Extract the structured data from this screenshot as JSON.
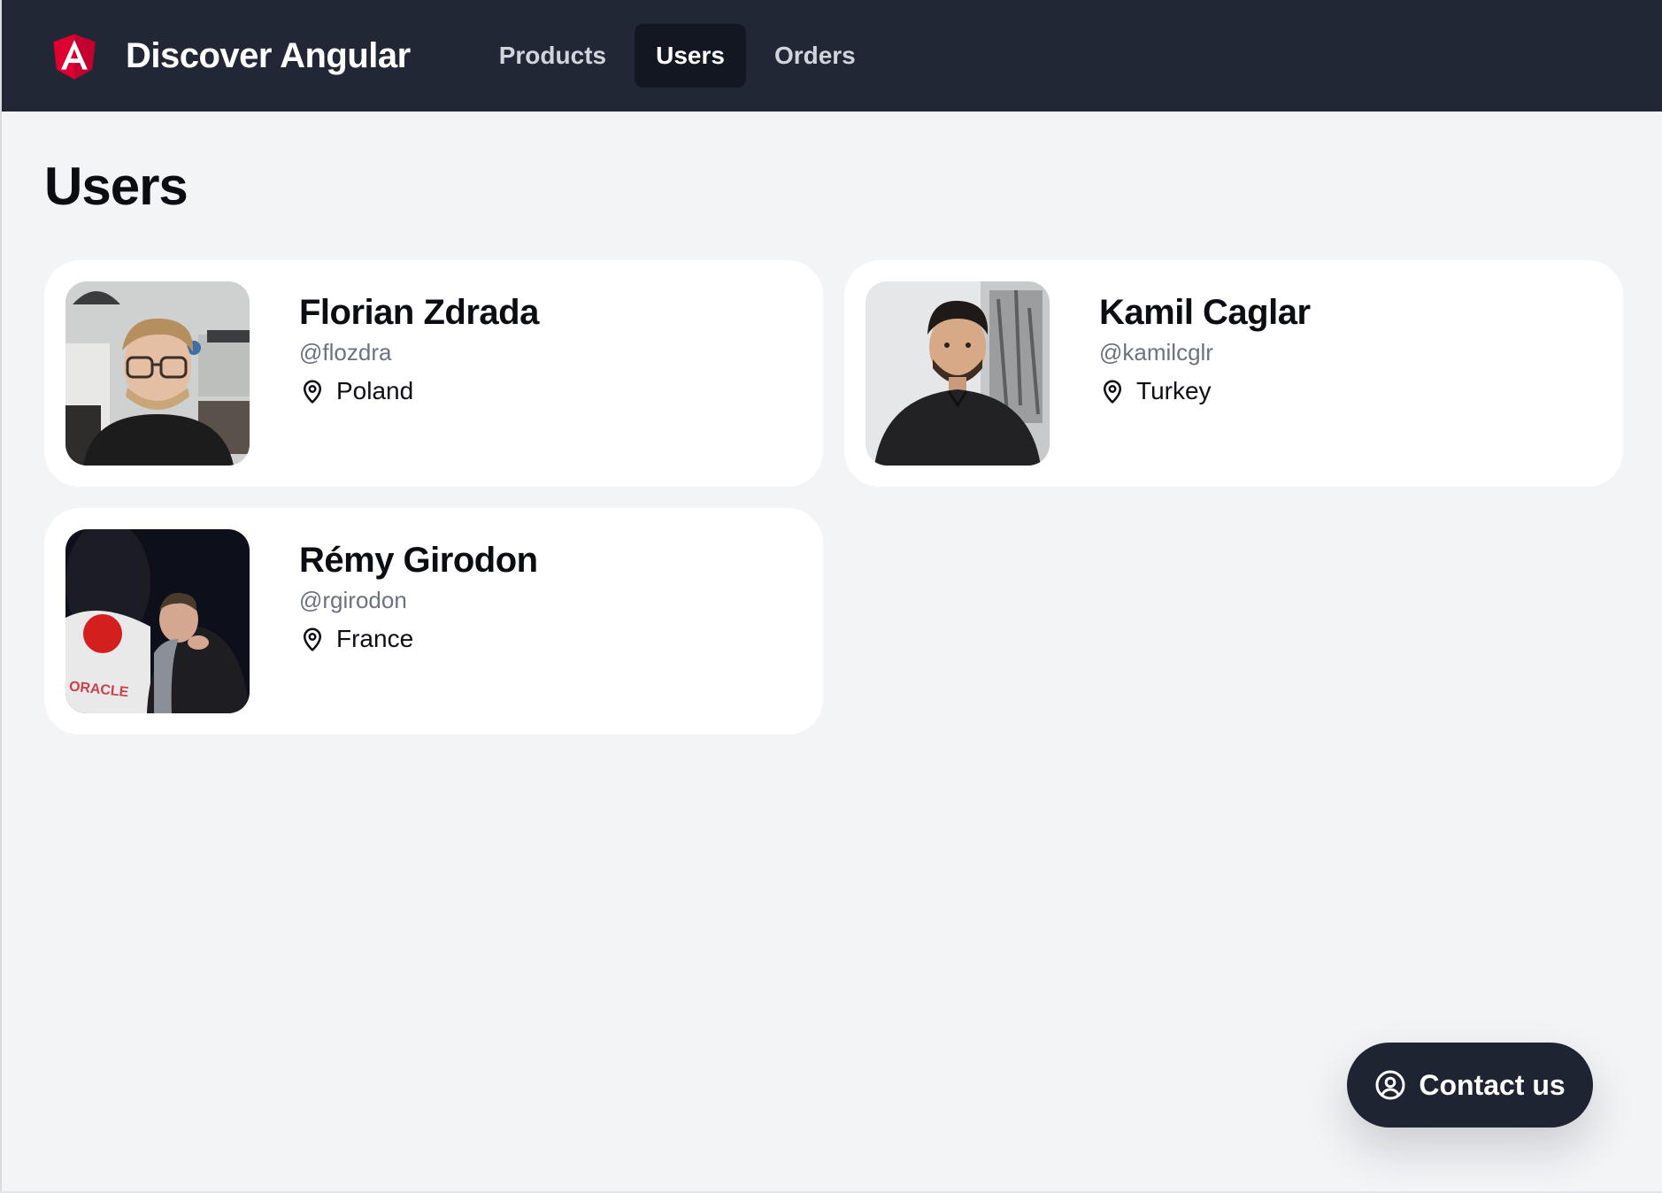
{
  "app": {
    "title": "Discover Angular",
    "logo_icon": "angular-logo-icon",
    "brand_color": "#dd0031"
  },
  "nav": {
    "items": [
      {
        "label": "Products",
        "active": false
      },
      {
        "label": "Users",
        "active": true
      },
      {
        "label": "Orders",
        "active": false
      }
    ]
  },
  "page": {
    "title": "Users"
  },
  "users": [
    {
      "name": "Florian Zdrada",
      "handle": "@flozdra",
      "location": "Poland",
      "icon": "map-pin-icon"
    },
    {
      "name": "Kamil Caglar",
      "handle": "@kamilcglr",
      "location": "Turkey",
      "icon": "map-pin-icon"
    },
    {
      "name": "Rémy Girodon",
      "handle": "@rgirodon",
      "location": "France",
      "icon": "map-pin-icon",
      "photo_text": "ORACLE"
    }
  ],
  "contact": {
    "label": "Contact us",
    "icon": "user-circle-icon"
  },
  "colors": {
    "header_bg": "#222735",
    "active_tab_bg": "#121722",
    "page_bg": "#f3f4f6",
    "card_bg": "#ffffff",
    "handle_text": "#6b7280",
    "contact_bg": "#1f2433"
  }
}
